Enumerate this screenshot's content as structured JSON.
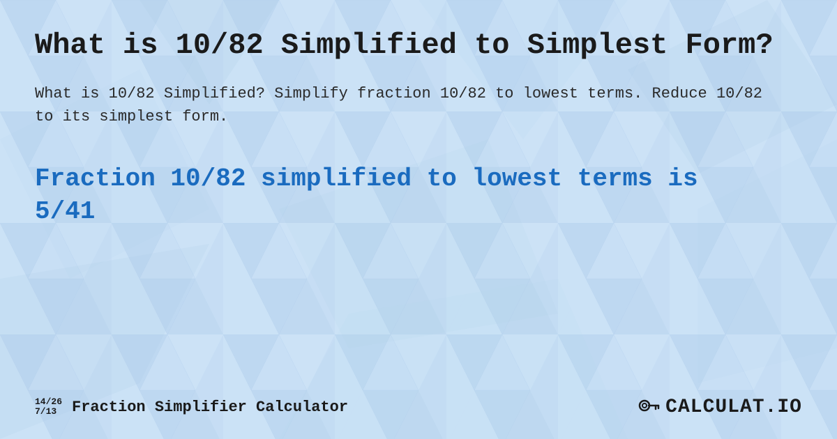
{
  "background": {
    "color": "#c8dff5"
  },
  "page": {
    "title": "What is 10/82 Simplified to Simplest Form?",
    "description": "What is 10/82 Simplified? Simplify fraction 10/82 to lowest terms. Reduce 10/82 to its simplest form.",
    "result_heading": "Fraction 10/82 simplified to lowest terms is 5/41"
  },
  "footer": {
    "fraction1": "14/26",
    "fraction2": "7/13",
    "site_title": "Fraction Simplifier Calculator",
    "logo_text": "CALCULAT.IO"
  }
}
